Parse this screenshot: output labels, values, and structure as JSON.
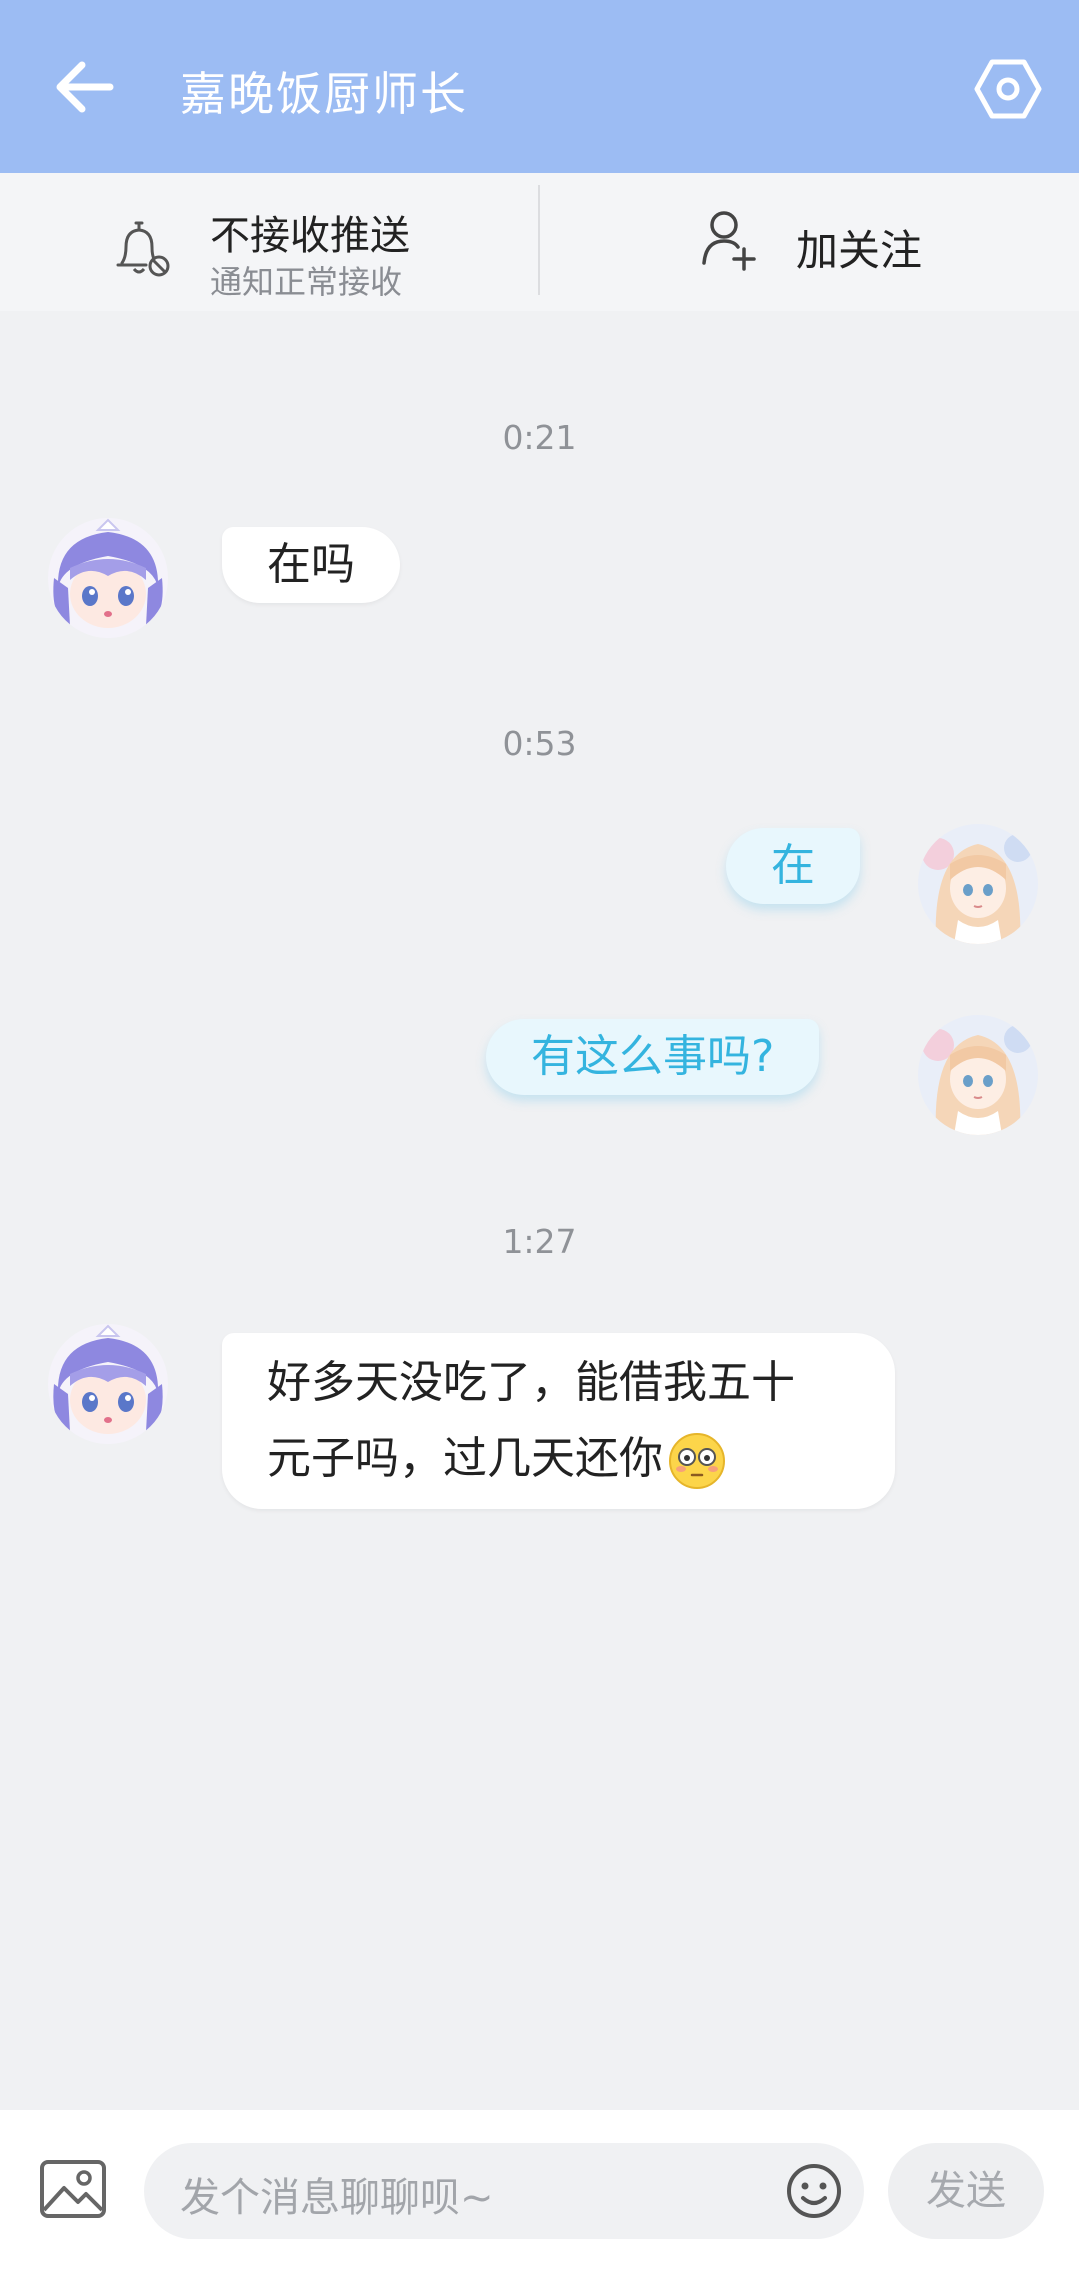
{
  "header": {
    "title": "嘉晚饭厨师长",
    "bg_color": "#9cbcf3",
    "back_icon": "arrow-left-icon",
    "settings_icon": "hexagon-settings-icon"
  },
  "notify": {
    "title": "不接收推送",
    "subtitle": "通知正常接收",
    "icon": "bell-muted-icon"
  },
  "follow": {
    "label": "加关注",
    "icon": "user-add-icon"
  },
  "messages": [
    {
      "time": "0:21"
    },
    {
      "side": "left",
      "text": "在吗"
    },
    {
      "time": "0:53"
    },
    {
      "side": "right",
      "text": "在"
    },
    {
      "side": "right",
      "text": "有这么事吗?"
    },
    {
      "time": "1:27"
    },
    {
      "side": "left",
      "line1": "好多天没吃了，能借我五十",
      "line2": "元子吗，过几天还你",
      "emoji": "flushed-face-emoji"
    }
  ],
  "composer": {
    "placeholder": "发个消息聊聊呗~",
    "send_label": "发送",
    "image_icon": "image-icon",
    "emoji_icon": "smiley-icon"
  },
  "colors": {
    "accent": "#9cbcf3",
    "right_bubble_text": "#34b4df",
    "right_bubble_bg": "#e8f7fd",
    "chat_bg": "#f0f1f3"
  }
}
